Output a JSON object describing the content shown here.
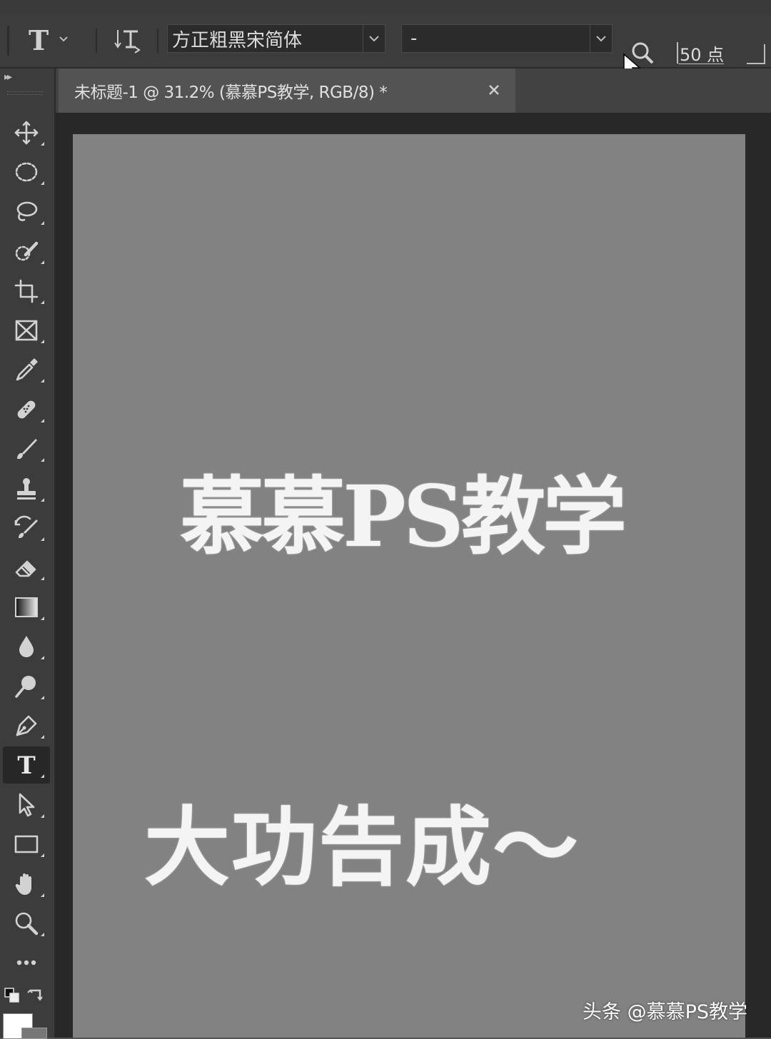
{
  "options_bar": {
    "tool_preset_glyph": "T",
    "font_family": "方正粗黑宋简体",
    "font_style": "-",
    "font_size": "50 点"
  },
  "toolbar": {
    "tools": [
      {
        "name": "move-tool",
        "icon": "move-icon"
      },
      {
        "name": "elliptical-marquee-tool",
        "icon": "ellipse-marquee-icon"
      },
      {
        "name": "lasso-tool",
        "icon": "lasso-icon"
      },
      {
        "name": "quick-selection-tool",
        "icon": "quick-selection-icon"
      },
      {
        "name": "crop-tool",
        "icon": "crop-icon"
      },
      {
        "name": "frame-tool",
        "icon": "frame-icon"
      },
      {
        "name": "eyedropper-tool",
        "icon": "eyedropper-icon"
      },
      {
        "name": "healing-brush-tool",
        "icon": "bandage-icon"
      },
      {
        "name": "brush-tool",
        "icon": "brush-icon"
      },
      {
        "name": "clone-stamp-tool",
        "icon": "stamp-icon"
      },
      {
        "name": "history-brush-tool",
        "icon": "history-brush-icon"
      },
      {
        "name": "eraser-tool",
        "icon": "eraser-icon"
      },
      {
        "name": "gradient-tool",
        "icon": "gradient-icon"
      },
      {
        "name": "blur-tool",
        "icon": "drop-icon"
      },
      {
        "name": "dodge-tool",
        "icon": "dodge-icon"
      },
      {
        "name": "pen-tool",
        "icon": "pen-icon"
      },
      {
        "name": "type-tool",
        "icon": "type-icon",
        "glyph": "T",
        "active": true
      },
      {
        "name": "path-selection-tool",
        "icon": "arrow-select-icon"
      },
      {
        "name": "rectangle-tool",
        "icon": "rectangle-icon"
      },
      {
        "name": "hand-tool",
        "icon": "hand-icon"
      },
      {
        "name": "zoom-tool",
        "icon": "zoom-icon"
      },
      {
        "name": "edit-toolbar",
        "icon": "more-icon"
      }
    ],
    "foreground_color": "#ffffff",
    "background_color": "#777777"
  },
  "document": {
    "tab_title": "未标题-1 @ 31.2% (慕慕PS教学, RGB/8) *",
    "canvas_color": "#828282",
    "text_layer_main": "慕慕PS教学",
    "text_layer_sub": "大功告成～"
  },
  "watermark": "头条 @慕慕PS教学"
}
